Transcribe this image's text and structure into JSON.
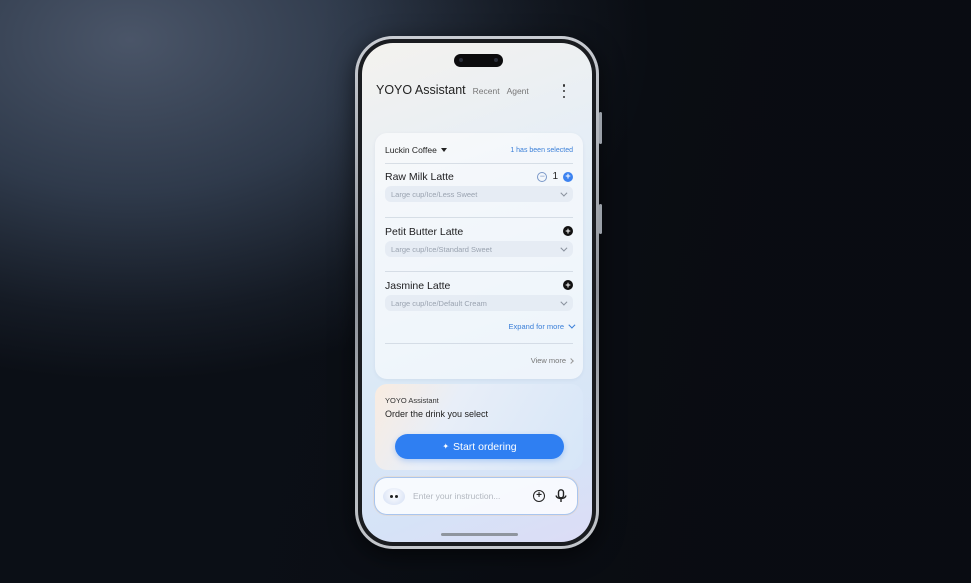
{
  "header": {
    "title": "YOYO Assistant",
    "tabs": [
      "Recent",
      "Agent"
    ],
    "more_icon": "more-vertical-icon"
  },
  "order_card": {
    "store": "Luckin Coffee",
    "selected_status": "1 has been selected",
    "items": [
      {
        "name": "Raw Milk Latte",
        "options": "Large cup/Ice/Less Sweet",
        "quantity": "1",
        "selected": true
      },
      {
        "name": "Petit Butter Latte",
        "options": "Large cup/Ice/Standard Sweet",
        "quantity": null,
        "selected": false
      },
      {
        "name": "Jasmine Latte",
        "options": "Large cup/Ice/Default Cream",
        "quantity": null,
        "selected": false
      }
    ],
    "expand_label": "Expand for more",
    "view_more_label": "View more"
  },
  "assistant_card": {
    "label": "YOYO Assistant",
    "message": "Order the drink you select",
    "button_label": "Start ordering",
    "button_icon": "sparkle-icon"
  },
  "input_bar": {
    "placeholder": "Enter your instruction...",
    "value": ""
  },
  "colors": {
    "accent": "#2f7ff2",
    "link": "#3a7fd8"
  },
  "symbols": {
    "minus": "−",
    "plus": "+",
    "sparkle": "✦"
  }
}
